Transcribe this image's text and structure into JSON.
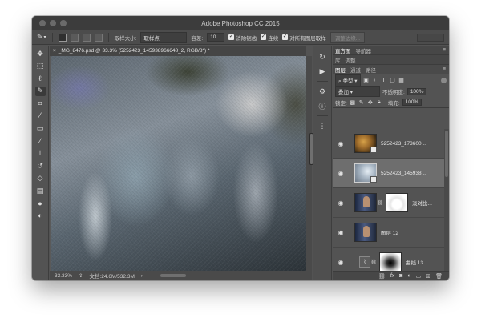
{
  "window": {
    "title": "Adobe Photoshop CC 2015"
  },
  "options_bar": {
    "tool_icon": "quick-selection-icon",
    "sample_size_label": "取样大小:",
    "sample_size_value": "取样点",
    "tolerance_label": "容差:",
    "tolerance_value": "10",
    "anti_alias_label": "消除锯齿",
    "anti_alias_checked": true,
    "contiguous_label": "连续",
    "contiguous_checked": true,
    "sample_all_label": "对所有图层取样",
    "sample_all_checked": true,
    "refine_edge_label": "调整边缘..."
  },
  "document": {
    "tab_title": "_MG_8476.psd @ 33.3% (5252423_145938966648_2, RGB/8*) *",
    "zoom": "33.33%",
    "doc_size": "文档:24.6M/532.3M"
  },
  "tools": [
    "move-icon",
    "marquee-icon",
    "lasso-icon",
    "quick-selection-icon",
    "crop-icon",
    "eyedropper-icon",
    "healing-brush-icon",
    "brush-icon",
    "clone-stamp-icon",
    "history-brush-icon",
    "eraser-icon",
    "gradient-icon",
    "blur-icon",
    "dodge-icon"
  ],
  "panels": {
    "top_tabs": [
      "直方图",
      "导航器"
    ],
    "adjust_tabs": [
      "库",
      "调整"
    ],
    "layers_tabs": [
      "图层",
      "通道",
      "路径"
    ],
    "filter_type": "类型",
    "blend_mode": "叠加",
    "opacity_label": "不透明度:",
    "opacity_value": "100%",
    "lock_label": "锁定:",
    "fill_label": "填充:",
    "fill_value": "100%"
  },
  "layers": [
    {
      "name": "5252423_173600...",
      "visible": true,
      "selected": false
    },
    {
      "name": "5252423_145938...",
      "visible": true,
      "selected": true
    },
    {
      "name": "淡对比...",
      "visible": true,
      "selected": false
    },
    {
      "name": "图层 12",
      "visible": true,
      "selected": false
    },
    {
      "name": "曲线 13",
      "visible": true,
      "selected": false
    }
  ],
  "footer_icons": [
    "link-icon",
    "fx-icon",
    "mask-icon",
    "adjustment-icon",
    "group-icon",
    "new-layer-icon",
    "trash-icon"
  ],
  "colors": {
    "ui_background": "#535353",
    "panel_dark": "#474747",
    "selected_layer": "#6e6e6e"
  }
}
